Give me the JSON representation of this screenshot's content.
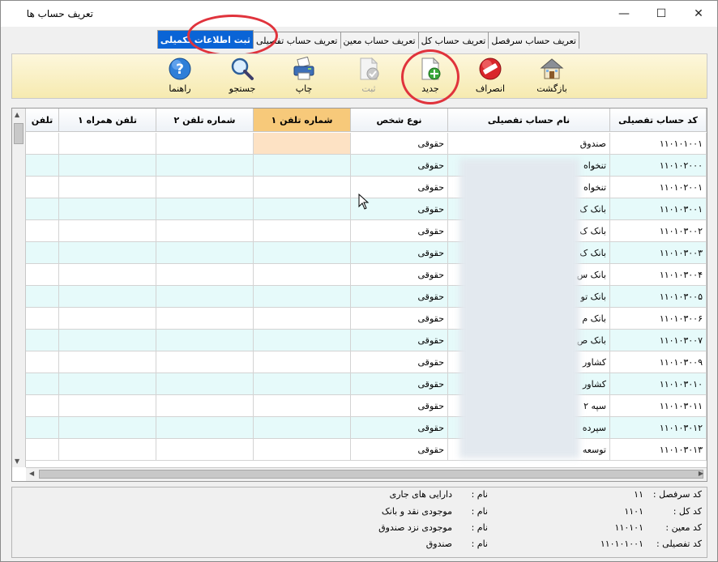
{
  "window": {
    "title": "تعریف حساب ها",
    "minimize_icon": "minimize-icon",
    "maximize_icon": "maximize-icon",
    "close_icon": "close-icon"
  },
  "tabs": [
    {
      "label": "تعریف حساب سرفصل",
      "active": false
    },
    {
      "label": "تعریف حساب کل",
      "active": false
    },
    {
      "label": "تعریف حساب معین",
      "active": false
    },
    {
      "label": "تعریف حساب تفصیلی",
      "active": false
    },
    {
      "label": "ثبت اطلاعات تکمیلی",
      "active": true
    }
  ],
  "toolbar": {
    "back": {
      "label": "بازگشت",
      "icon": "house-icon"
    },
    "cancel": {
      "label": "انصراف",
      "icon": "no-entry-icon"
    },
    "new": {
      "label": "جدید",
      "icon": "new-document-icon"
    },
    "save": {
      "label": "ثبت",
      "icon": "save-document-icon",
      "disabled": true
    },
    "print": {
      "label": "چاپ",
      "icon": "printer-icon"
    },
    "search": {
      "label": "جستجو",
      "icon": "magnifier-icon"
    },
    "help": {
      "label": "راهنما",
      "icon": "help-icon"
    }
  },
  "grid": {
    "columns": [
      "کد حساب تفصیلی",
      "نام حساب تفصیلی",
      "نوع شخص",
      "شماره تلفن ۱",
      "شماره تلفن ۲",
      "تلفن همراه ۱",
      "تلفن"
    ],
    "selected_column": "شماره تلفن ۱",
    "rows": [
      {
        "code": "۱۱۰۱۰۱۰۰۱",
        "name": "صندوق",
        "type": "حقوقی"
      },
      {
        "code": "۱۱۰۱۰۲۰۰۰",
        "name": "تنخواه",
        "type": "حقوقی"
      },
      {
        "code": "۱۱۰۱۰۲۰۰۱",
        "name": "تنخواه",
        "type": "حقوقی"
      },
      {
        "code": "۱۱۰۱۰۳۰۰۱",
        "name": "بانک ک",
        "type": "حقوقی"
      },
      {
        "code": "۱۱۰۱۰۳۰۰۲",
        "name": "بانک ک",
        "type": "حقوقی"
      },
      {
        "code": "۱۱۰۱۰۳۰۰۳",
        "name": "بانک ک",
        "type": "حقوقی"
      },
      {
        "code": "۱۱۰۱۰۳۰۰۴",
        "name": "بانک س",
        "type": "حقوقی"
      },
      {
        "code": "۱۱۰۱۰۳۰۰۵",
        "name": "بانک تو",
        "type": "حقوقی"
      },
      {
        "code": "۱۱۰۱۰۳۰۰۶",
        "name": "بانک م",
        "type": "حقوقی"
      },
      {
        "code": "۱۱۰۱۰۳۰۰۷",
        "name": "بانک ص",
        "type": "حقوقی"
      },
      {
        "code": "۱۱۰۱۰۳۰۰۹",
        "name": "کشاور",
        "type": "حقوقی"
      },
      {
        "code": "۱۱۰۱۰۳۰۱۰",
        "name": "کشاور",
        "type": "حقوقی"
      },
      {
        "code": "۱۱۰۱۰۳۰۱۱",
        "name": "سپه ۲",
        "type": "حقوقی"
      },
      {
        "code": "۱۱۰۱۰۳۰۱۲",
        "name": "سپرده",
        "type": "حقوقی"
      },
      {
        "code": "۱۱۰۱۰۳۰۱۳",
        "name": "توسعه",
        "type": "حقوقی"
      }
    ]
  },
  "info": {
    "rows": [
      {
        "label": "کد سرفصل :",
        "code": "۱۱",
        "name_label": "نام :",
        "name": "دارایی های جاری"
      },
      {
        "label": "کد کل :",
        "code": "۱۱۰۱",
        "name_label": "نام :",
        "name": "موجودی نقد و بانک"
      },
      {
        "label": "کد معین :",
        "code": "۱۱۰۱۰۱",
        "name_label": "نام :",
        "name": "موجودی نزد صندوق"
      },
      {
        "label": "کد تفصیلی :",
        "code": "۱۱۰۱۰۱۰۰۱",
        "name_label": "نام :",
        "name": "صندوق"
      }
    ]
  },
  "colors": {
    "active_tab": "#0a64d6",
    "highlight_circle": "#e0333c",
    "alt_row": "#e6fafa",
    "selected_header": "#f7c97a",
    "selected_cell": "#fde2c4"
  }
}
